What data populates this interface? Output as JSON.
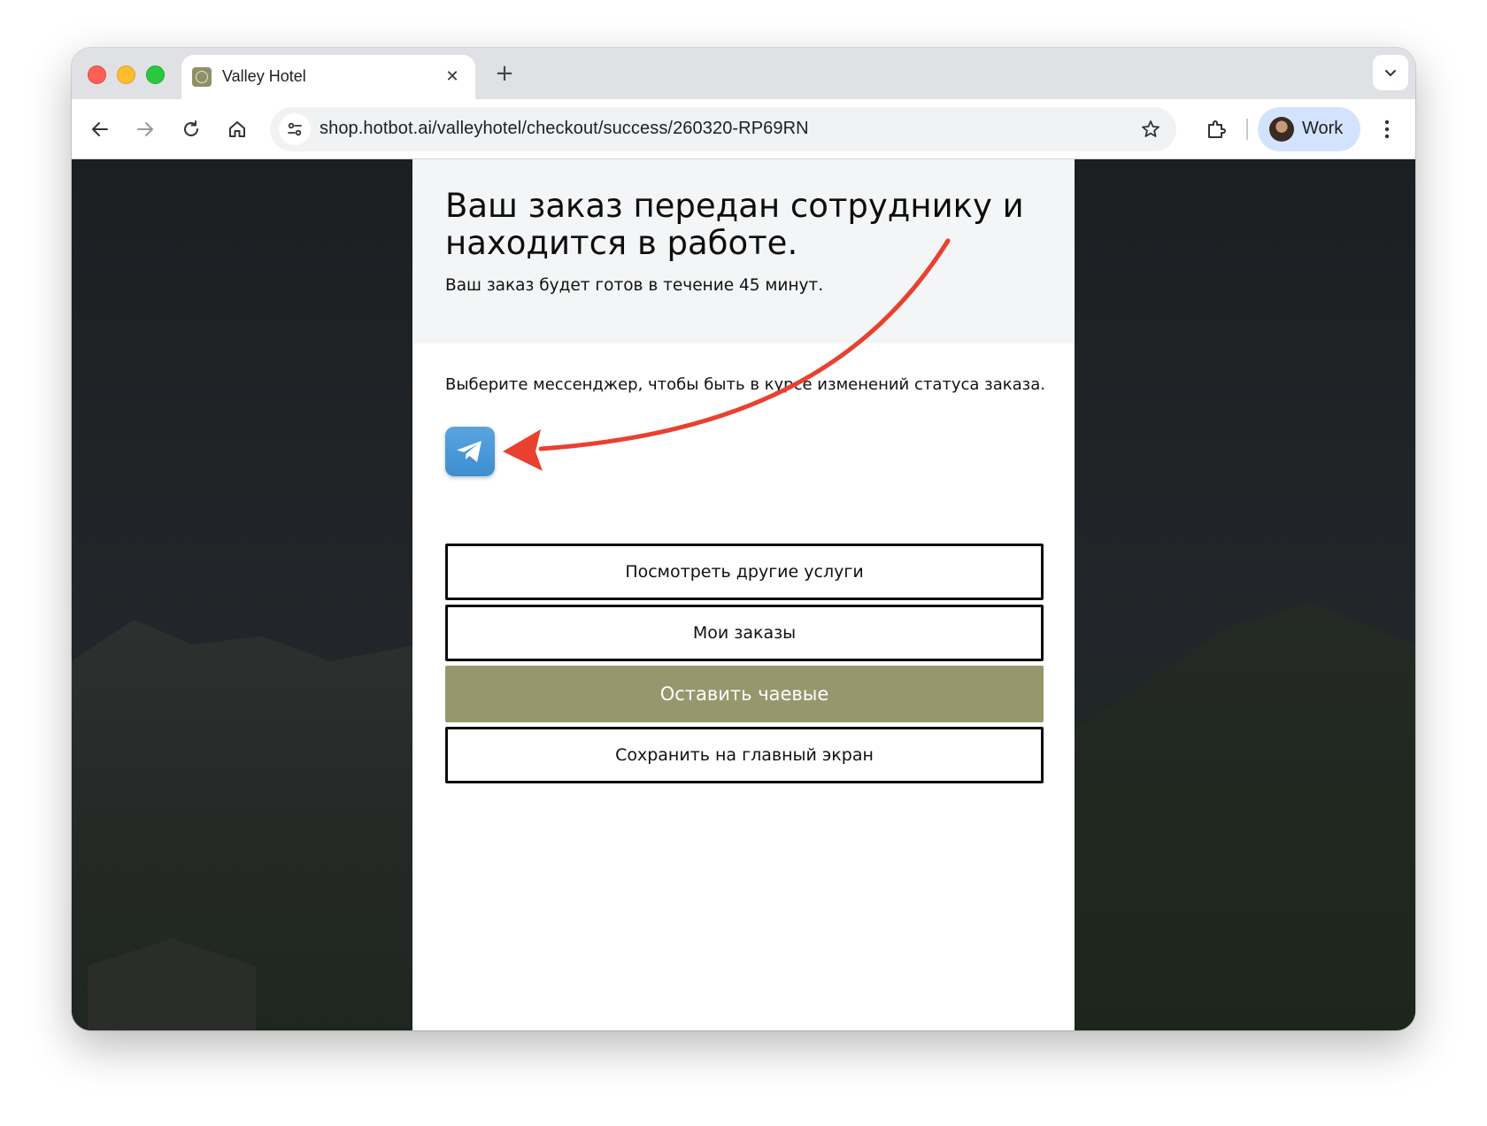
{
  "browser": {
    "tab_title": "Valley Hotel",
    "tab_close": "✕",
    "new_tab": "+",
    "url": "shop.hotbot.ai/valleyhotel/checkout/success/260320-RP69RN",
    "profile_label": "Work",
    "icons": [
      "back-icon",
      "forward-icon",
      "reload-icon",
      "home-icon",
      "site-settings-icon",
      "bookmark-star-icon",
      "extensions-icon",
      "more-menu-icon",
      "tab-search-icon"
    ]
  },
  "page": {
    "title": "Ваш заказ передан сотруднику и находится в работе.",
    "subtitle": "Ваш заказ будет готов в течение 45 минут.",
    "messenger_prompt": "Выберите мессенджер, чтобы быть в курсе изменений статуса заказа.",
    "messenger_icon": "telegram-icon",
    "buttons": {
      "other_services": "Посмотреть другие услуги",
      "my_orders": "Мои заказы",
      "tip": "Оставить чаевые",
      "save_home": "Сохранить на главный экран"
    }
  },
  "colors": {
    "tip_button": "#96976d",
    "telegram": "#3c8fd1",
    "annotation_arrow": "#e8412f",
    "profile_chip": "#d3e3fd"
  }
}
